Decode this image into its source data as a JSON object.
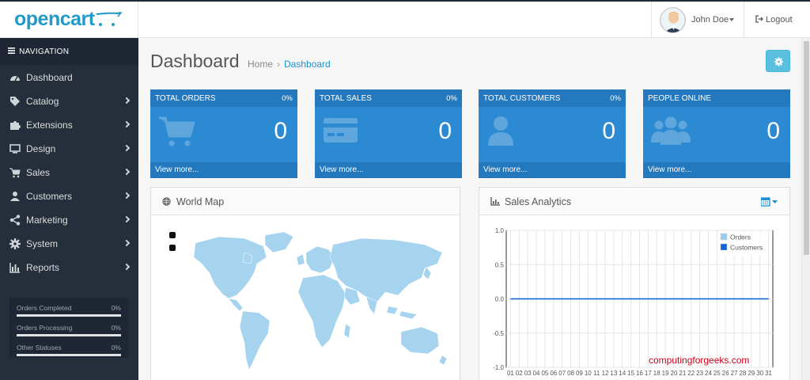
{
  "brand": {
    "logo_text": "opencart"
  },
  "header": {
    "user": {
      "name": "John Doe",
      "avatar": "user-avatar"
    },
    "logout_label": "Logout"
  },
  "sidebar": {
    "heading": "NAVIGATION",
    "items": [
      {
        "label": "Dashboard",
        "icon": "dashboard-icon",
        "has_children": false
      },
      {
        "label": "Catalog",
        "icon": "tag-icon",
        "has_children": true
      },
      {
        "label": "Extensions",
        "icon": "puzzle-icon",
        "has_children": true
      },
      {
        "label": "Design",
        "icon": "monitor-icon",
        "has_children": true
      },
      {
        "label": "Sales",
        "icon": "cart-icon",
        "has_children": true
      },
      {
        "label": "Customers",
        "icon": "user-icon",
        "has_children": true
      },
      {
        "label": "Marketing",
        "icon": "share-icon",
        "has_children": true
      },
      {
        "label": "System",
        "icon": "gear-icon",
        "has_children": true
      },
      {
        "label": "Reports",
        "icon": "bar-chart-icon",
        "has_children": true
      }
    ],
    "statuses": [
      {
        "label": "Orders Completed",
        "value": "0%"
      },
      {
        "label": "Orders Processing",
        "value": "0%"
      },
      {
        "label": "Other Statuses",
        "value": "0%"
      }
    ]
  },
  "page": {
    "title": "Dashboard",
    "breadcrumb": {
      "home": "Home",
      "current": "Dashboard"
    }
  },
  "tiles": [
    {
      "title": "TOTAL ORDERS",
      "percent": "0%",
      "value": "0",
      "link": "View more...",
      "icon": "cart-icon"
    },
    {
      "title": "TOTAL SALES",
      "percent": "0%",
      "value": "0",
      "link": "View more...",
      "icon": "credit-card-icon"
    },
    {
      "title": "TOTAL CUSTOMERS",
      "percent": "0%",
      "value": "0",
      "link": "View more...",
      "icon": "user-icon"
    },
    {
      "title": "PEOPLE ONLINE",
      "percent": "",
      "value": "0",
      "link": "View more...",
      "icon": "users-icon"
    }
  ],
  "panels": {
    "world_map": {
      "title": "World Map",
      "icon": "globe-icon"
    },
    "sales_analytics": {
      "title": "Sales Analytics",
      "icon": "area-chart-icon"
    }
  },
  "chart_data": {
    "type": "line",
    "title": "",
    "x": [
      "01",
      "02",
      "03",
      "04",
      "05",
      "06",
      "07",
      "08",
      "09",
      "10",
      "11",
      "12",
      "13",
      "14",
      "15",
      "16",
      "17",
      "18",
      "19",
      "20",
      "21",
      "22",
      "23",
      "24",
      "25",
      "26",
      "27",
      "28",
      "29",
      "30",
      "31"
    ],
    "yticks": [
      "1.0",
      "0.5",
      "0.0",
      "-0.5",
      "-1.0"
    ],
    "ylim": [
      -1,
      1
    ],
    "grid": true,
    "legend_position": "top-right",
    "series": [
      {
        "name": "Orders",
        "values": [
          0,
          0,
          0,
          0,
          0,
          0,
          0,
          0,
          0,
          0,
          0,
          0,
          0,
          0,
          0,
          0,
          0,
          0,
          0,
          0,
          0,
          0,
          0,
          0,
          0,
          0,
          0,
          0,
          0,
          0,
          0
        ]
      },
      {
        "name": "Customers",
        "values": [
          0,
          0,
          0,
          0,
          0,
          0,
          0,
          0,
          0,
          0,
          0,
          0,
          0,
          0,
          0,
          0,
          0,
          0,
          0,
          0,
          0,
          0,
          0,
          0,
          0,
          0,
          0,
          0,
          0,
          0,
          0
        ]
      }
    ],
    "colors": {
      "Orders": "#9bcbef",
      "Customers": "#1065d2"
    }
  },
  "watermark": "computingforgeeks.com",
  "theme": {
    "accent": "#1e91cf",
    "sidebar_bg": "#242f3b",
    "tile_bg": "#2b8ad2"
  }
}
